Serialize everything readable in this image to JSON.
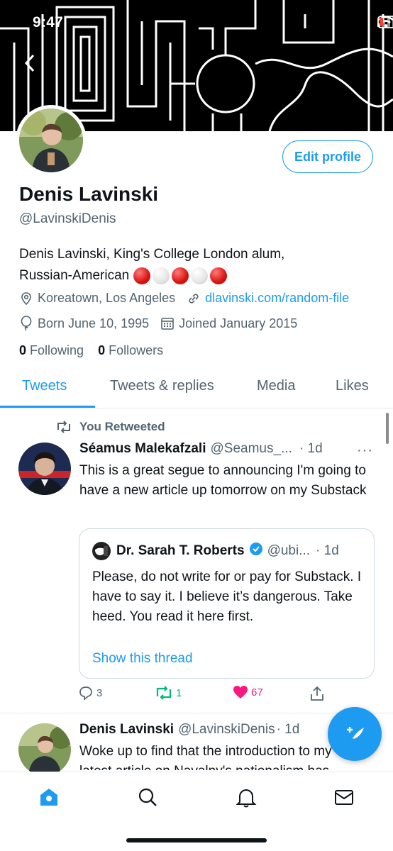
{
  "status_bar": {
    "time": "9:47"
  },
  "profile": {
    "name": "Denis Lavinski",
    "handle": "@LavinskiDenis",
    "edit_label": "Edit profile",
    "bio_line1": "Denis Lavinski, King's College London alum,",
    "bio_line2": "Russian-American",
    "location": "Koreatown, Los Angeles",
    "website": "dlavinski.com/random-file",
    "birthday": "Born June 10, 1995",
    "joined": "Joined January 2015",
    "following_count": "0",
    "following_label": "Following",
    "followers_count": "0",
    "followers_label": "Followers"
  },
  "tabs": [
    {
      "label": "Tweets",
      "active": true
    },
    {
      "label": "Tweets & replies",
      "active": false
    },
    {
      "label": "Media",
      "active": false
    },
    {
      "label": "Likes",
      "active": false
    }
  ],
  "tweets": [
    {
      "retweet_label": "You Retweeted",
      "author": "Séamus Malekafzali",
      "handle": "@Seamus_...",
      "time": "· 1d",
      "text": "This is a great segue to announcing I'm going to have a new article up tomorrow on my Substack",
      "quote": {
        "author": "Dr. Sarah T. Roberts",
        "handle": "@ubi...",
        "time": "· 1d",
        "text": "Please, do not write for or pay for Substack. I have to say it. I believe it’s dangerous. Take heed. You read it here first.",
        "show_thread": "Show this thread"
      },
      "replies": "3",
      "retweets": "1",
      "likes": "67"
    },
    {
      "author": "Denis Lavinski",
      "handle": "@LavinskiDenis",
      "time": "· 1d",
      "text": "Woke up to find that the introduction to my latest article on Navalny's nationalism has"
    }
  ],
  "icons": {
    "back": "chevron-left-icon",
    "location": "location-pin-icon",
    "link": "link-icon",
    "birthday": "balloon-icon",
    "calendar": "calendar-icon",
    "retweet": "retweet-icon",
    "reply": "reply-icon",
    "like": "heart-icon",
    "share": "share-icon",
    "compose": "compose-icon",
    "home": "home-icon",
    "search": "search-icon",
    "notifications": "bell-icon",
    "messages": "mail-icon"
  },
  "colors": {
    "accent": "#1d9bf0",
    "retweet_green": "#00ba7c",
    "like_pink": "#f91880",
    "secondary_text": "#536471"
  }
}
